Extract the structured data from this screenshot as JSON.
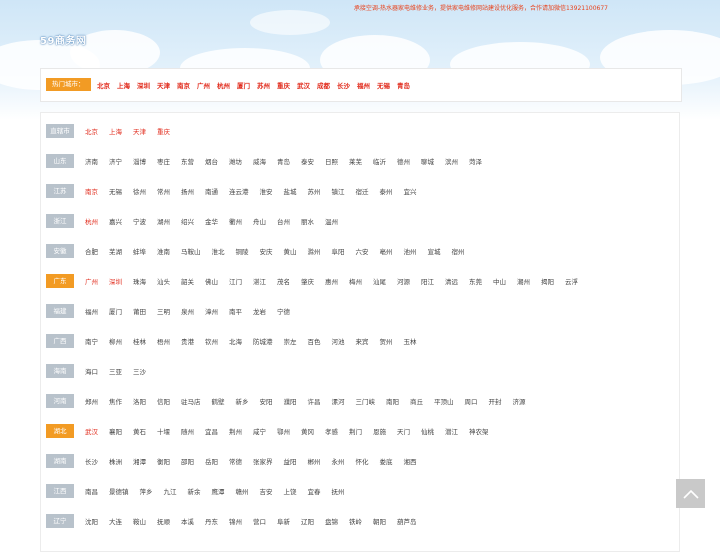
{
  "header": {
    "notice": "承接空调-热水器家电维修业务，提供家电维修网站建设优化服务，合作请加微信13921100677",
    "logo": "59商务网"
  },
  "hot": {
    "label": "热门城市：",
    "cities": [
      "北京",
      "上海",
      "深圳",
      "天津",
      "南京",
      "广州",
      "杭州",
      "厦门",
      "苏州",
      "重庆",
      "武汉",
      "成都",
      "长沙",
      "福州",
      "无锡",
      "青岛"
    ]
  },
  "provinces": [
    {
      "name": "直辖市",
      "active": false,
      "cities": [
        {
          "n": "北京",
          "red": true
        },
        {
          "n": "上海",
          "red": true
        },
        {
          "n": "天津",
          "red": true
        },
        {
          "n": "重庆",
          "red": true
        }
      ]
    },
    {
      "name": "山东",
      "active": false,
      "cities": [
        {
          "n": "济南"
        },
        {
          "n": "济宁"
        },
        {
          "n": "淄博"
        },
        {
          "n": "枣庄"
        },
        {
          "n": "东营"
        },
        {
          "n": "烟台"
        },
        {
          "n": "潍坊"
        },
        {
          "n": "威海"
        },
        {
          "n": "青岛"
        },
        {
          "n": "泰安"
        },
        {
          "n": "日照"
        },
        {
          "n": "莱芜"
        },
        {
          "n": "临沂"
        },
        {
          "n": "德州"
        },
        {
          "n": "聊城"
        },
        {
          "n": "滨州"
        },
        {
          "n": "菏泽"
        }
      ]
    },
    {
      "name": "江苏",
      "active": false,
      "cities": [
        {
          "n": "南京",
          "red": true
        },
        {
          "n": "无锡"
        },
        {
          "n": "徐州"
        },
        {
          "n": "常州"
        },
        {
          "n": "扬州"
        },
        {
          "n": "南通"
        },
        {
          "n": "连云港"
        },
        {
          "n": "淮安"
        },
        {
          "n": "盐城"
        },
        {
          "n": "苏州"
        },
        {
          "n": "镇江"
        },
        {
          "n": "宿迁"
        },
        {
          "n": "泰州"
        },
        {
          "n": "宜兴"
        }
      ]
    },
    {
      "name": "浙江",
      "active": false,
      "cities": [
        {
          "n": "杭州",
          "red": true
        },
        {
          "n": "嘉兴"
        },
        {
          "n": "宁波"
        },
        {
          "n": "湖州"
        },
        {
          "n": "绍兴"
        },
        {
          "n": "金华"
        },
        {
          "n": "衢州"
        },
        {
          "n": "舟山"
        },
        {
          "n": "台州"
        },
        {
          "n": "丽水"
        },
        {
          "n": "温州"
        }
      ]
    },
    {
      "name": "安徽",
      "active": false,
      "cities": [
        {
          "n": "合肥"
        },
        {
          "n": "芜湖"
        },
        {
          "n": "蚌埠"
        },
        {
          "n": "淮南"
        },
        {
          "n": "马鞍山"
        },
        {
          "n": "淮北"
        },
        {
          "n": "铜陵"
        },
        {
          "n": "安庆"
        },
        {
          "n": "黄山"
        },
        {
          "n": "滁州"
        },
        {
          "n": "阜阳"
        },
        {
          "n": "六安"
        },
        {
          "n": "亳州"
        },
        {
          "n": "池州"
        },
        {
          "n": "宣城"
        },
        {
          "n": "宿州"
        }
      ]
    },
    {
      "name": "广东",
      "active": true,
      "cities": [
        {
          "n": "广州",
          "red": true
        },
        {
          "n": "深圳",
          "red": true
        },
        {
          "n": "珠海"
        },
        {
          "n": "汕头"
        },
        {
          "n": "韶关"
        },
        {
          "n": "佛山"
        },
        {
          "n": "江门"
        },
        {
          "n": "湛江"
        },
        {
          "n": "茂名"
        },
        {
          "n": "肇庆"
        },
        {
          "n": "惠州"
        },
        {
          "n": "梅州"
        },
        {
          "n": "汕尾"
        },
        {
          "n": "河源"
        },
        {
          "n": "阳江"
        },
        {
          "n": "清远"
        },
        {
          "n": "东莞"
        },
        {
          "n": "中山"
        },
        {
          "n": "潮州"
        },
        {
          "n": "揭阳"
        },
        {
          "n": "云浮"
        }
      ]
    },
    {
      "name": "福建",
      "active": false,
      "cities": [
        {
          "n": "福州"
        },
        {
          "n": "厦门"
        },
        {
          "n": "莆田"
        },
        {
          "n": "三明"
        },
        {
          "n": "泉州"
        },
        {
          "n": "漳州"
        },
        {
          "n": "南平"
        },
        {
          "n": "龙岩"
        },
        {
          "n": "宁德"
        }
      ]
    },
    {
      "name": "广西",
      "active": false,
      "cities": [
        {
          "n": "南宁"
        },
        {
          "n": "柳州"
        },
        {
          "n": "桂林"
        },
        {
          "n": "梧州"
        },
        {
          "n": "贵港"
        },
        {
          "n": "钦州"
        },
        {
          "n": "北海"
        },
        {
          "n": "防城港"
        },
        {
          "n": "崇左"
        },
        {
          "n": "百色"
        },
        {
          "n": "河池"
        },
        {
          "n": "来宾"
        },
        {
          "n": "贺州"
        },
        {
          "n": "玉林"
        }
      ]
    },
    {
      "name": "海南",
      "active": false,
      "cities": [
        {
          "n": "海口"
        },
        {
          "n": "三亚"
        },
        {
          "n": "三沙"
        }
      ]
    },
    {
      "name": "河南",
      "active": false,
      "cities": [
        {
          "n": "郑州"
        },
        {
          "n": "焦作"
        },
        {
          "n": "洛阳"
        },
        {
          "n": "信阳"
        },
        {
          "n": "驻马店"
        },
        {
          "n": "鹤壁"
        },
        {
          "n": "新乡"
        },
        {
          "n": "安阳"
        },
        {
          "n": "濮阳"
        },
        {
          "n": "许昌"
        },
        {
          "n": "漯河"
        },
        {
          "n": "三门峡"
        },
        {
          "n": "南阳"
        },
        {
          "n": "商丘"
        },
        {
          "n": "平顶山"
        },
        {
          "n": "周口"
        },
        {
          "n": "开封"
        },
        {
          "n": "济源"
        }
      ]
    },
    {
      "name": "湖北",
      "active": true,
      "cities": [
        {
          "n": "武汉",
          "red": true
        },
        {
          "n": "襄阳"
        },
        {
          "n": "黄石"
        },
        {
          "n": "十堰"
        },
        {
          "n": "随州"
        },
        {
          "n": "宜昌"
        },
        {
          "n": "荆州"
        },
        {
          "n": "咸宁"
        },
        {
          "n": "鄂州"
        },
        {
          "n": "黄冈"
        },
        {
          "n": "孝感"
        },
        {
          "n": "荆门"
        },
        {
          "n": "恩施"
        },
        {
          "n": "天门"
        },
        {
          "n": "仙桃"
        },
        {
          "n": "潜江"
        },
        {
          "n": "神农架"
        }
      ]
    },
    {
      "name": "湖南",
      "active": false,
      "cities": [
        {
          "n": "长沙"
        },
        {
          "n": "株洲"
        },
        {
          "n": "湘潭"
        },
        {
          "n": "衡阳"
        },
        {
          "n": "邵阳"
        },
        {
          "n": "岳阳"
        },
        {
          "n": "常德"
        },
        {
          "n": "张家界"
        },
        {
          "n": "益阳"
        },
        {
          "n": "郴州"
        },
        {
          "n": "永州"
        },
        {
          "n": "怀化"
        },
        {
          "n": "娄底"
        },
        {
          "n": "湘西"
        }
      ]
    },
    {
      "name": "江西",
      "active": false,
      "cities": [
        {
          "n": "南昌"
        },
        {
          "n": "景德镇"
        },
        {
          "n": "萍乡"
        },
        {
          "n": "九江"
        },
        {
          "n": "新余"
        },
        {
          "n": "鹰潭"
        },
        {
          "n": "赣州"
        },
        {
          "n": "吉安"
        },
        {
          "n": "上饶"
        },
        {
          "n": "宜春"
        },
        {
          "n": "抚州"
        }
      ]
    },
    {
      "name": "辽宁",
      "active": false,
      "cities": [
        {
          "n": "沈阳"
        },
        {
          "n": "大连"
        },
        {
          "n": "鞍山"
        },
        {
          "n": "抚顺"
        },
        {
          "n": "本溪"
        },
        {
          "n": "丹东"
        },
        {
          "n": "锦州"
        },
        {
          "n": "营口"
        },
        {
          "n": "阜新"
        },
        {
          "n": "辽阳"
        },
        {
          "n": "盘锦"
        },
        {
          "n": "铁岭"
        },
        {
          "n": "朝阳"
        },
        {
          "n": "葫芦岛"
        }
      ]
    }
  ],
  "colors": {
    "accent": "#f29b24",
    "link_red": "#e12b1c",
    "label_gray": "#b8c2cb"
  },
  "icons": {
    "back_to_top": "chevron-up-icon"
  }
}
